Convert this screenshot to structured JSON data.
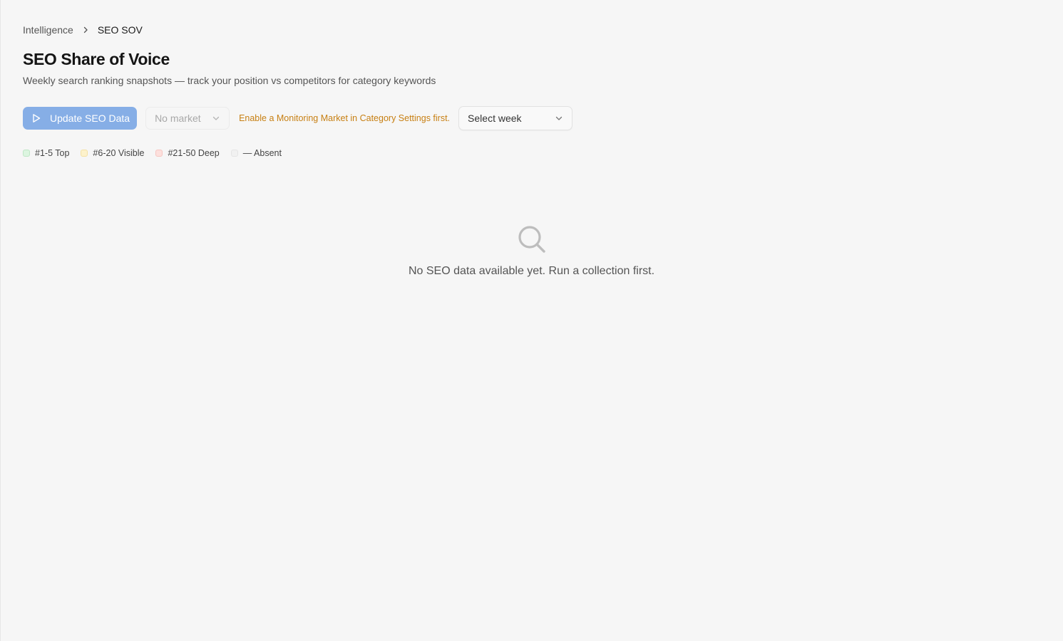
{
  "breadcrumb": {
    "parent": "Intelligence",
    "current": "SEO SOV"
  },
  "page": {
    "title": "SEO Share of Voice",
    "subtitle": "Weekly search ranking snapshots — track your position vs competitors for category keywords"
  },
  "toolbar": {
    "update_label": "Update SEO Data",
    "update_icon": "play-icon",
    "market_value": "No market",
    "warning": "Enable a Monitoring Market in Category Settings first.",
    "week_placeholder": "Select week"
  },
  "legend": {
    "items": [
      {
        "label": "#1-5 Top"
      },
      {
        "label": "#6-20 Visible"
      },
      {
        "label": "#21-50 Deep"
      },
      {
        "label": "— Absent"
      }
    ]
  },
  "empty_state": {
    "icon": "search-icon",
    "message": "No SEO data available yet. Run a collection first."
  },
  "colors": {
    "background": "#f6f6f6",
    "primary_button_disabled": "#86aee6",
    "warning": "#c77f12",
    "top": "#dcf5e0",
    "visible": "#fdf2cc",
    "deep": "#fde0dd",
    "absent": "#f1f1f1"
  }
}
